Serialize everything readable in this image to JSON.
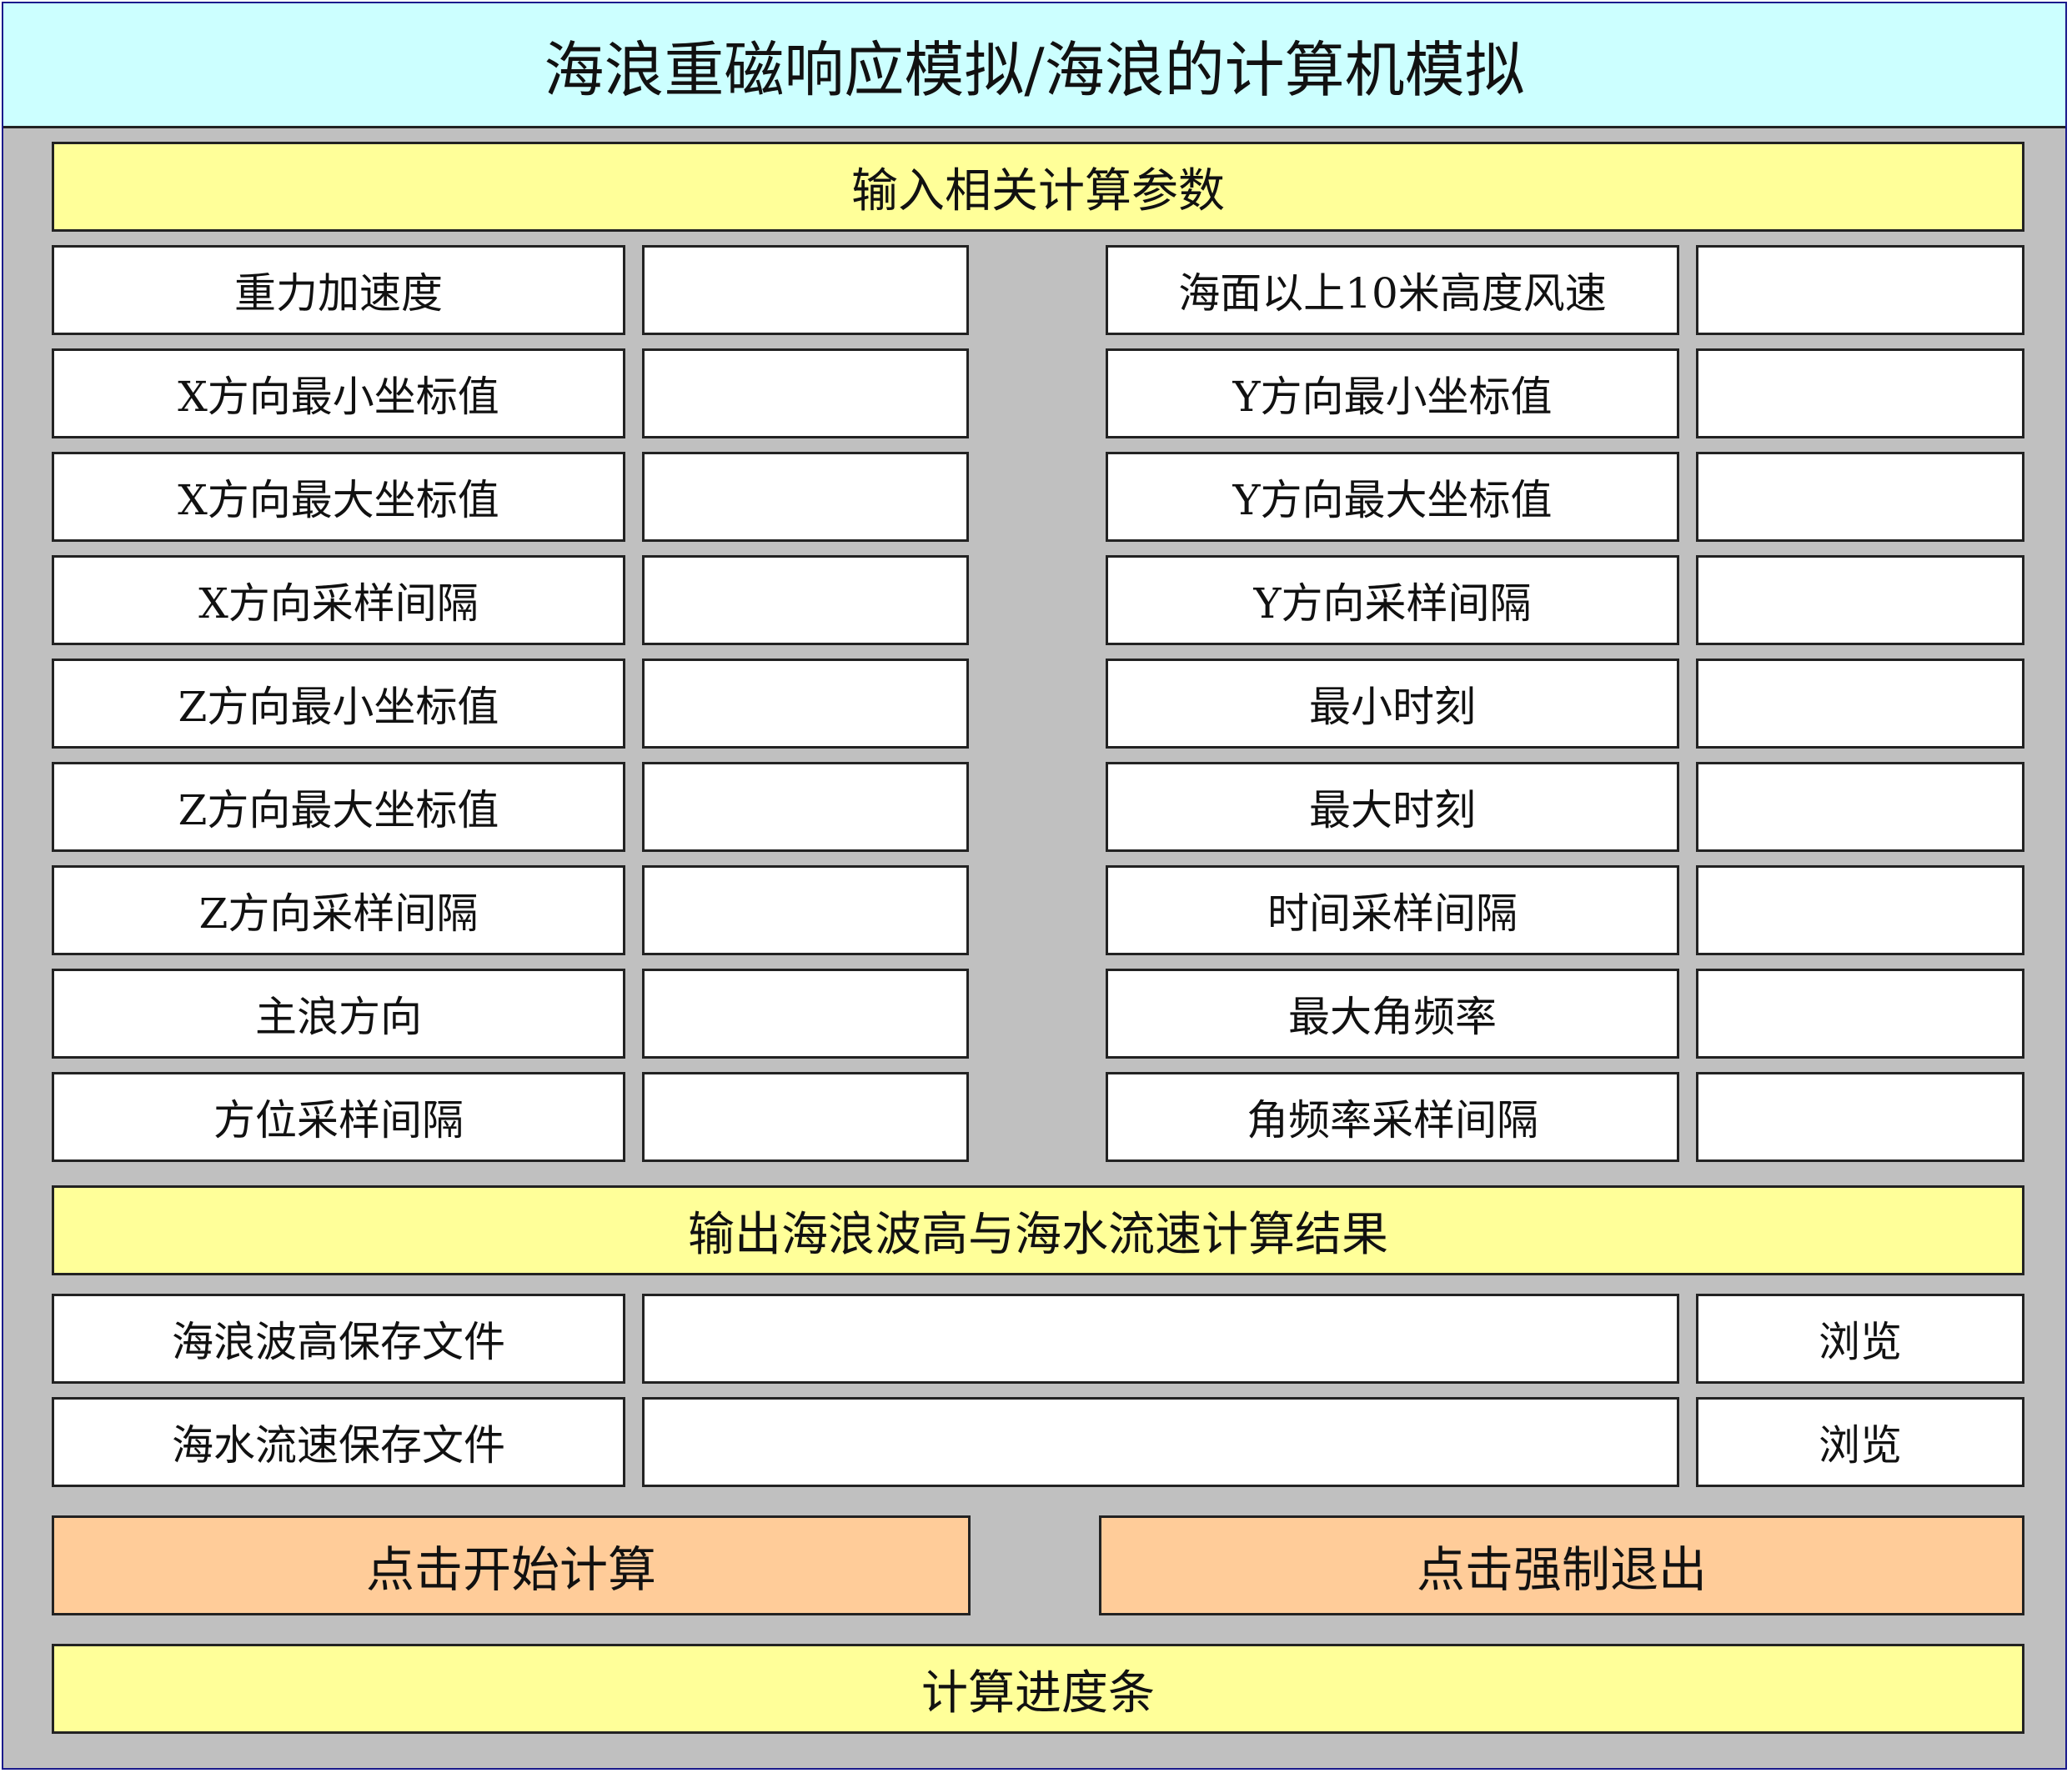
{
  "window": {
    "title": "海浪重磁响应模拟/海浪的计算机模拟"
  },
  "input_section": {
    "header": "输入相关计算参数",
    "left_params": [
      {
        "label": "重力加速度",
        "value": ""
      },
      {
        "label": "X方向最小坐标值",
        "value": ""
      },
      {
        "label": "X方向最大坐标值",
        "value": ""
      },
      {
        "label": "X方向采样间隔",
        "value": ""
      },
      {
        "label": "Z方向最小坐标值",
        "value": ""
      },
      {
        "label": "Z方向最大坐标值",
        "value": ""
      },
      {
        "label": "Z方向采样间隔",
        "value": ""
      },
      {
        "label": "主浪方向",
        "value": ""
      },
      {
        "label": "方位采样间隔",
        "value": ""
      }
    ],
    "right_params": [
      {
        "label": "海面以上10米高度风速",
        "value": ""
      },
      {
        "label": "Y方向最小坐标值",
        "value": ""
      },
      {
        "label": "Y方向最大坐标值",
        "value": ""
      },
      {
        "label": "Y方向采样间隔",
        "value": ""
      },
      {
        "label": "最小时刻",
        "value": ""
      },
      {
        "label": "最大时刻",
        "value": ""
      },
      {
        "label": "时间采样间隔",
        "value": ""
      },
      {
        "label": "最大角频率",
        "value": ""
      },
      {
        "label": "角频率采样间隔",
        "value": ""
      }
    ]
  },
  "output_section": {
    "header": "输出海浪波高与海水流速计算结果",
    "files": [
      {
        "label": "海浪波高保存文件",
        "path": "",
        "browse_label": "浏览"
      },
      {
        "label": "海水流速保存文件",
        "path": "",
        "browse_label": "浏览"
      }
    ]
  },
  "actions": {
    "start_label": "点击开始计算",
    "exit_label": "点击强制退出"
  },
  "progress": {
    "label": "计算进度条",
    "fraction": 0
  }
}
